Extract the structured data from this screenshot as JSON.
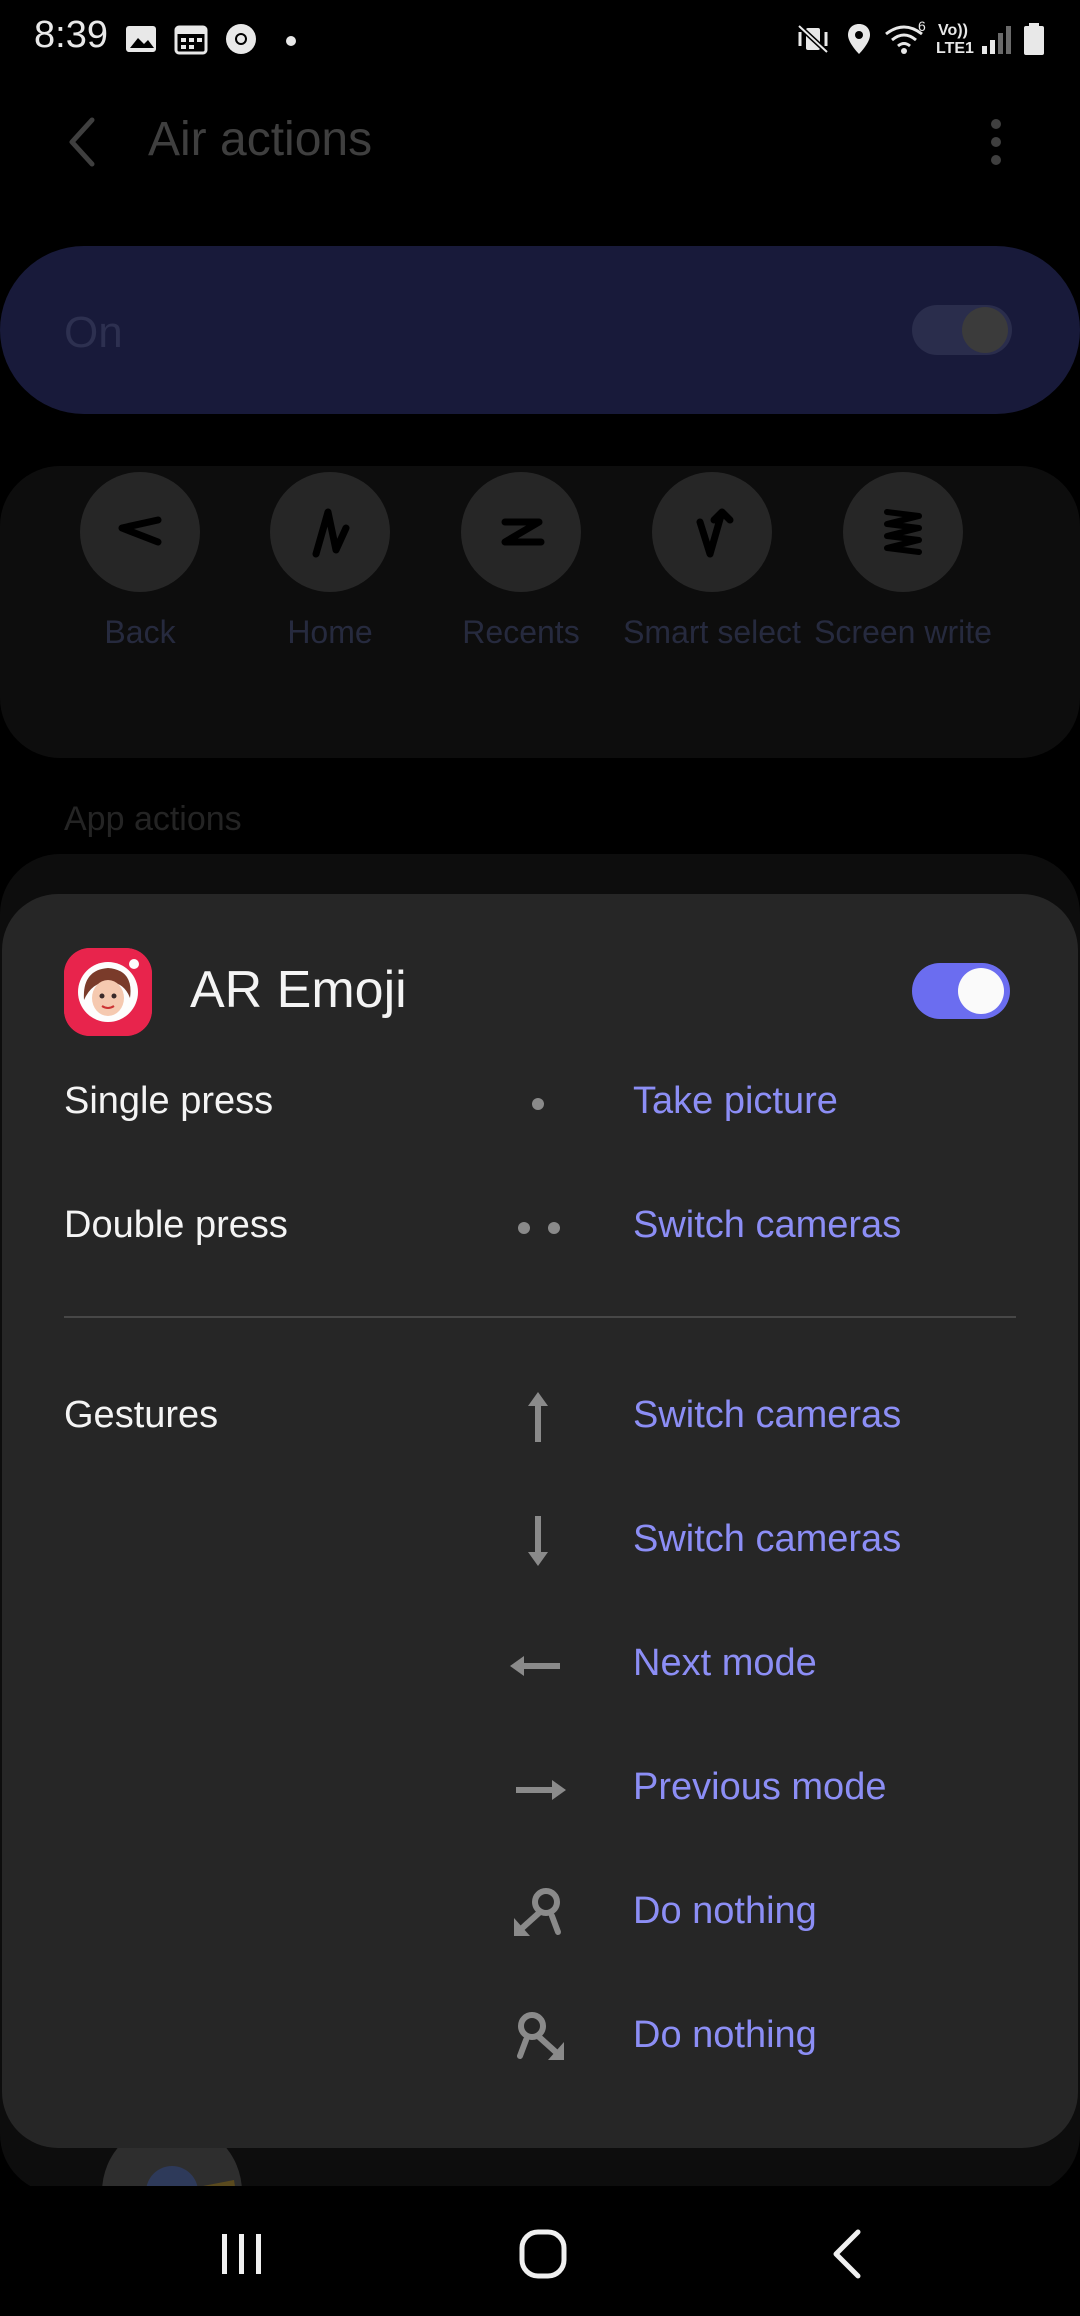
{
  "status_bar": {
    "time": "8:39",
    "lte_label": "LTE1",
    "volte_label": "Vo))",
    "wifi_number": "6"
  },
  "app_bar": {
    "title": "Air actions"
  },
  "master_switch": {
    "label": "On",
    "on": true
  },
  "gestures": [
    {
      "label": "Back",
      "icon": "back-gesture-icon"
    },
    {
      "label": "Home",
      "icon": "home-gesture-icon"
    },
    {
      "label": "Recents",
      "icon": "recents-gesture-icon"
    },
    {
      "label": "Smart select",
      "icon": "smart-select-gesture-icon"
    },
    {
      "label": "Screen write",
      "icon": "screen-write-gesture-icon"
    }
  ],
  "section_header": "App actions",
  "popup": {
    "app_name": "AR Emoji",
    "enabled": true,
    "single_press": {
      "label": "Single press",
      "value": "Take picture"
    },
    "double_press": {
      "label": "Double press",
      "value": "Switch cameras"
    },
    "gestures_label": "Gestures",
    "gesture_actions": [
      {
        "direction": "up",
        "value": "Switch cameras"
      },
      {
        "direction": "down",
        "value": "Switch cameras"
      },
      {
        "direction": "left",
        "value": "Next mode"
      },
      {
        "direction": "right",
        "value": "Previous mode"
      },
      {
        "direction": "circle-left",
        "value": "Do nothing"
      },
      {
        "direction": "circle-right",
        "value": "Do nothing"
      }
    ]
  },
  "colors": {
    "accent": "#8c8ef5",
    "toggle_on": "#6b6df0",
    "card": "#262626",
    "app_icon_bg": "#e8244c"
  }
}
